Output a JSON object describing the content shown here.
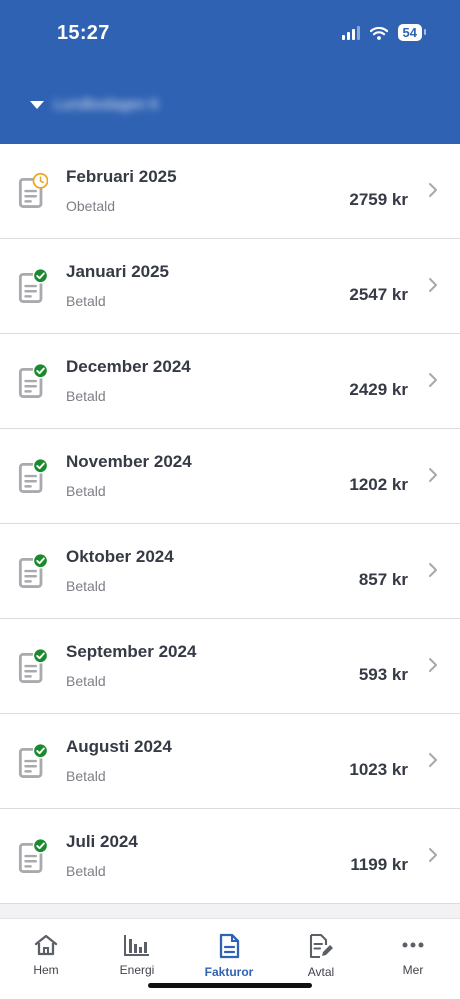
{
  "status_bar": {
    "time": "15:27",
    "battery": "54"
  },
  "header": {
    "account_name": "Lundbodagen 6"
  },
  "invoices": [
    {
      "title": "Februari 2025",
      "status": "Obetald",
      "amount": "2759 kr",
      "state": "pending"
    },
    {
      "title": "Januari 2025",
      "status": "Betald",
      "amount": "2547 kr",
      "state": "paid"
    },
    {
      "title": "December 2024",
      "status": "Betald",
      "amount": "2429 kr",
      "state": "paid"
    },
    {
      "title": "November 2024",
      "status": "Betald",
      "amount": "1202 kr",
      "state": "paid"
    },
    {
      "title": "Oktober 2024",
      "status": "Betald",
      "amount": "857 kr",
      "state": "paid"
    },
    {
      "title": "September 2024",
      "status": "Betald",
      "amount": "593 kr",
      "state": "paid"
    },
    {
      "title": "Augusti 2024",
      "status": "Betald",
      "amount": "1023 kr",
      "state": "paid"
    },
    {
      "title": "Juli 2024",
      "status": "Betald",
      "amount": "1199 kr",
      "state": "paid"
    }
  ],
  "tabs": [
    {
      "label": "Hem",
      "icon": "home-icon"
    },
    {
      "label": "Energi",
      "icon": "bar-chart-icon"
    },
    {
      "label": "Fakturor",
      "icon": "document-icon",
      "active": true
    },
    {
      "label": "Avtal",
      "icon": "contract-edit-icon"
    },
    {
      "label": "Mer",
      "icon": "more-icon"
    }
  ],
  "colors": {
    "brand": "#2f62b3",
    "paid": "#1a8a2e",
    "pending": "#f0a31a",
    "icon_gray": "#a9aaad"
  }
}
